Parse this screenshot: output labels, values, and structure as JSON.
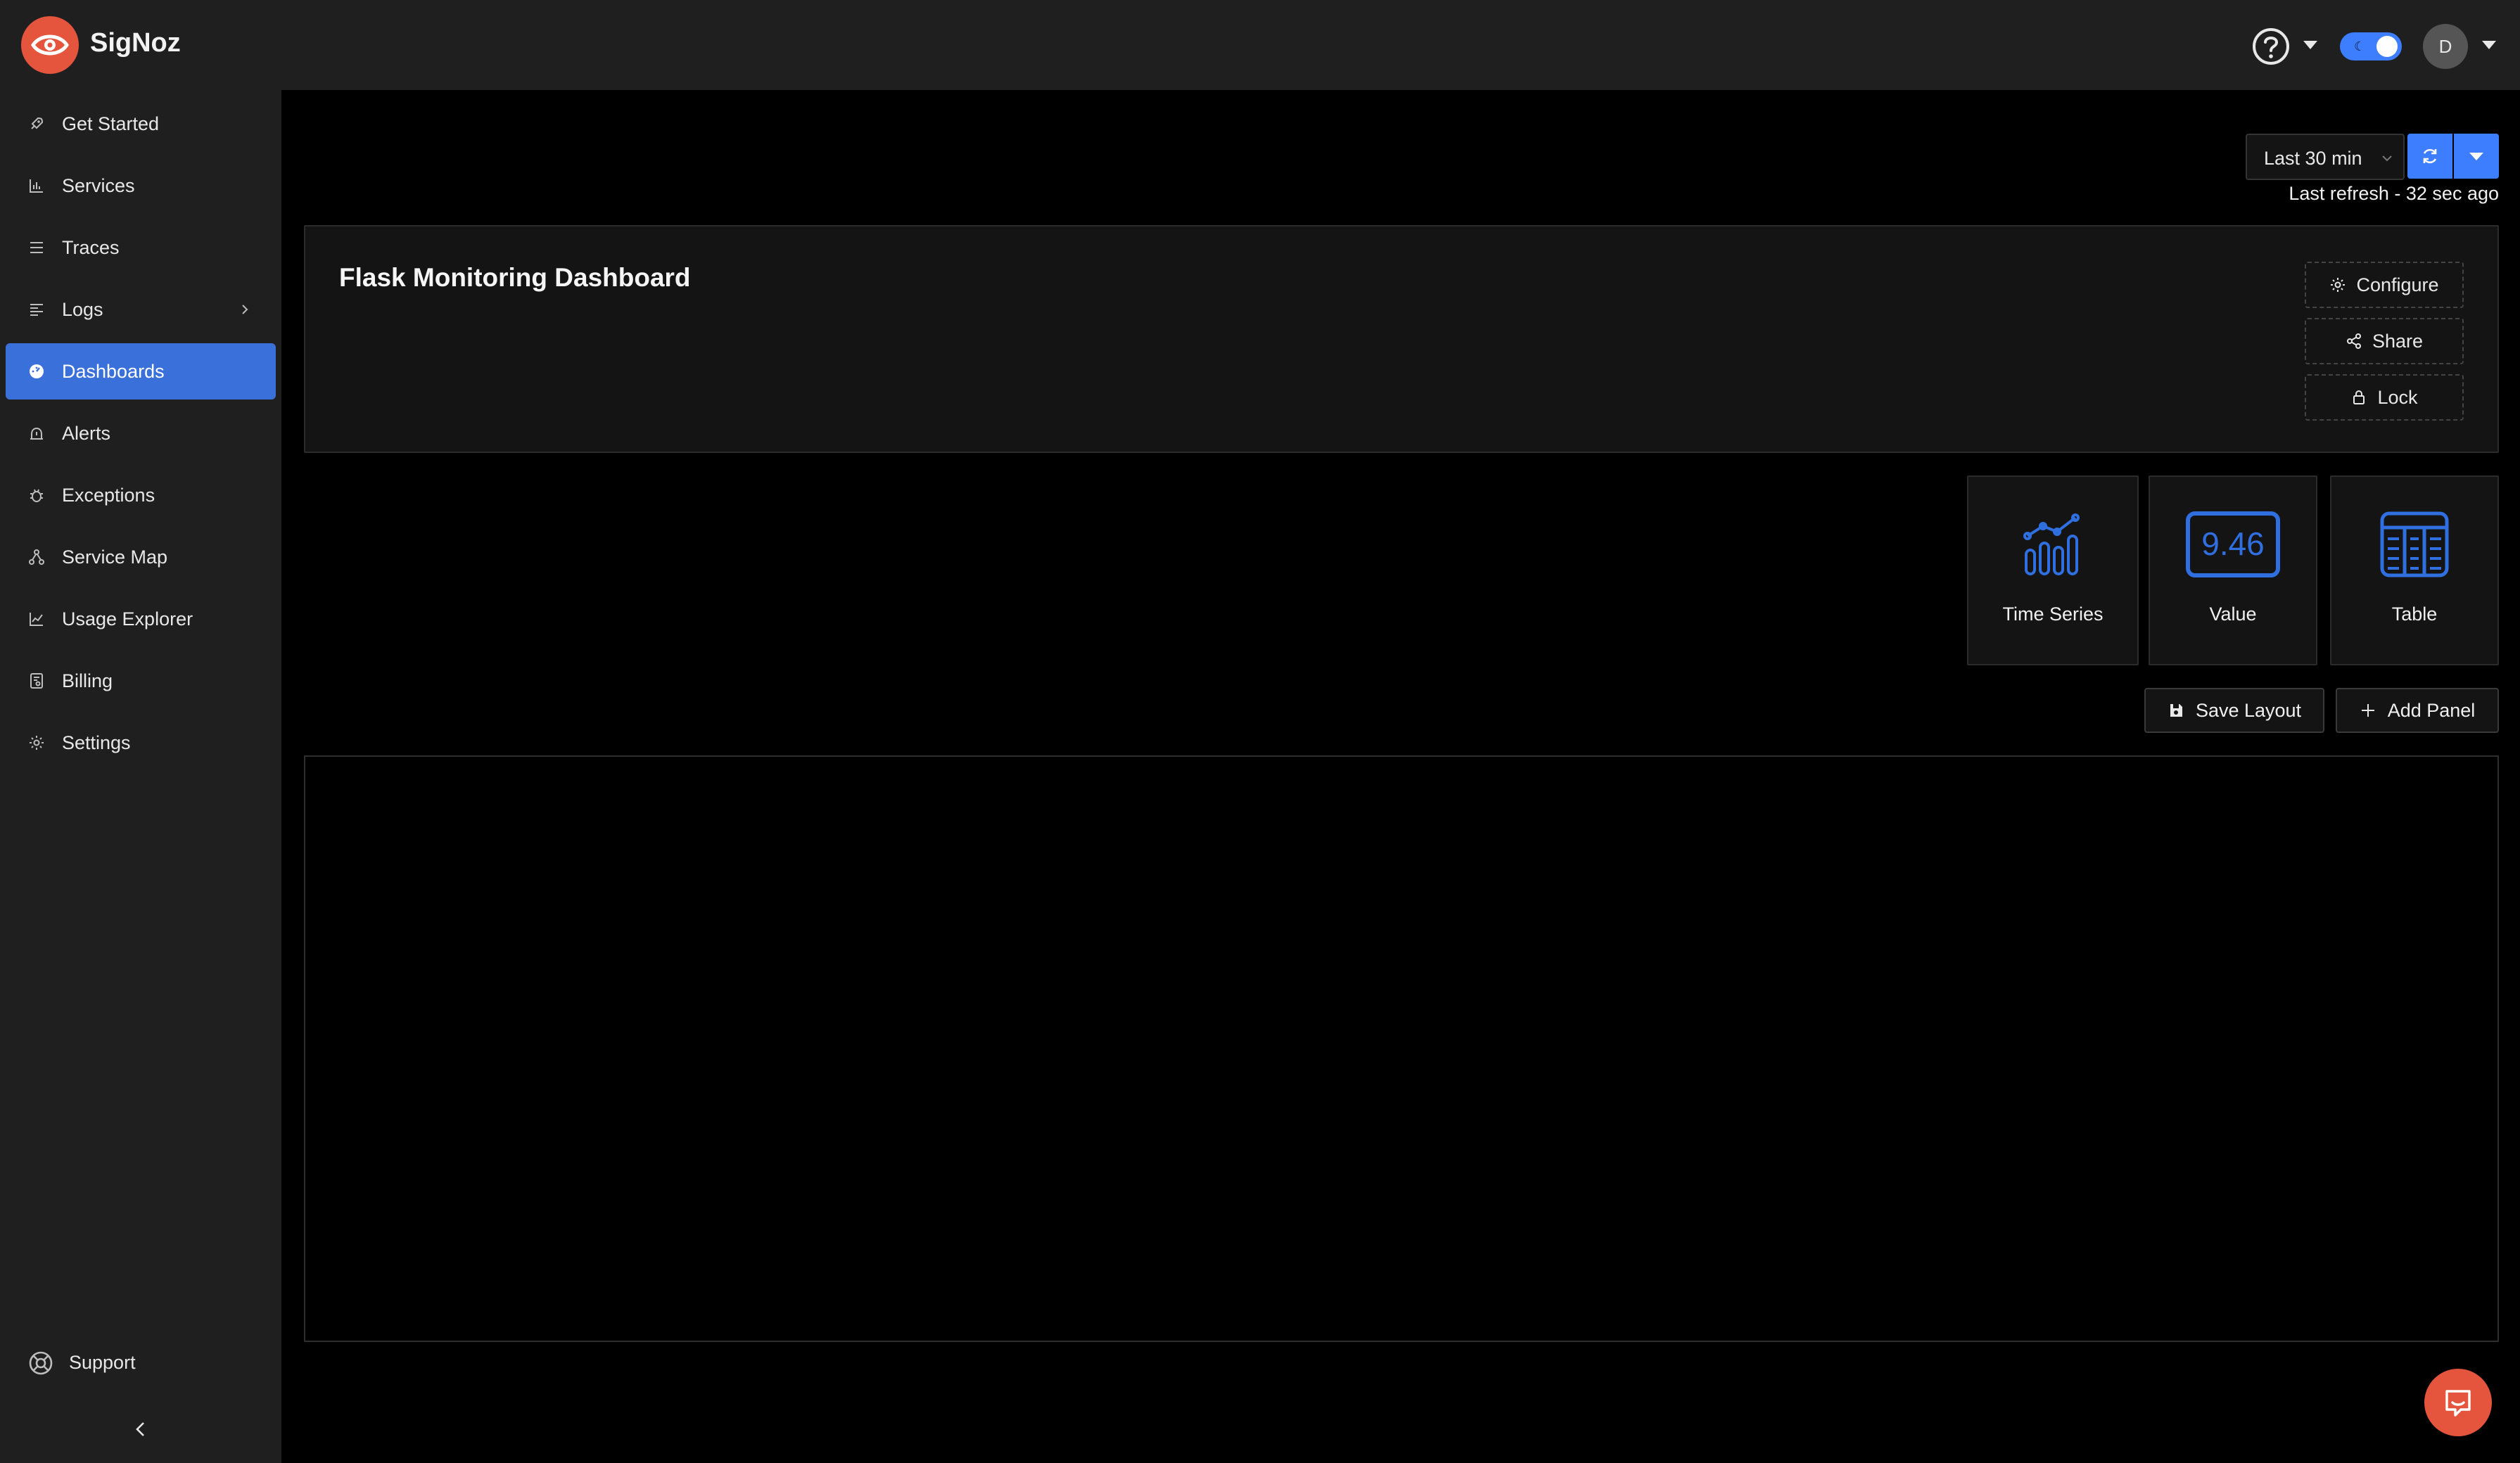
{
  "app": {
    "name": "SigNoz"
  },
  "header": {
    "avatar_initial": "D"
  },
  "sidebar": {
    "items": [
      {
        "label": "Get Started",
        "icon": "rocket-icon"
      },
      {
        "label": "Services",
        "icon": "bar-chart-icon"
      },
      {
        "label": "Traces",
        "icon": "menu-icon"
      },
      {
        "label": "Logs",
        "icon": "align-left-icon"
      },
      {
        "label": "Dashboards",
        "icon": "dashboard-icon",
        "active": true
      },
      {
        "label": "Alerts",
        "icon": "alarm-icon"
      },
      {
        "label": "Exceptions",
        "icon": "bug-icon"
      },
      {
        "label": "Service Map",
        "icon": "deployment-icon"
      },
      {
        "label": "Usage Explorer",
        "icon": "line-chart-icon"
      },
      {
        "label": "Billing",
        "icon": "billing-icon"
      },
      {
        "label": "Settings",
        "icon": "gear-icon"
      }
    ],
    "support_label": "Support"
  },
  "toolbar": {
    "time_range": "Last 30 min",
    "last_refresh": "Last refresh - 32 sec ago"
  },
  "dashboard": {
    "title": "Flask Monitoring Dashboard",
    "configure_label": "Configure",
    "share_label": "Share",
    "lock_label": "Lock"
  },
  "panel_types": [
    {
      "label": "Time Series",
      "icon": "time-series-icon"
    },
    {
      "label": "Value",
      "icon": "value-icon",
      "sample": "9.46"
    },
    {
      "label": "Table",
      "icon": "table-icon"
    }
  ],
  "actions": {
    "save_layout_label": "Save Layout",
    "add_panel_label": "Add Panel"
  },
  "colors": {
    "accent": "#3d7eff",
    "brand": "#e5553d",
    "active_nav": "#3a70d9",
    "icon_blue": "#2f6fe0"
  }
}
